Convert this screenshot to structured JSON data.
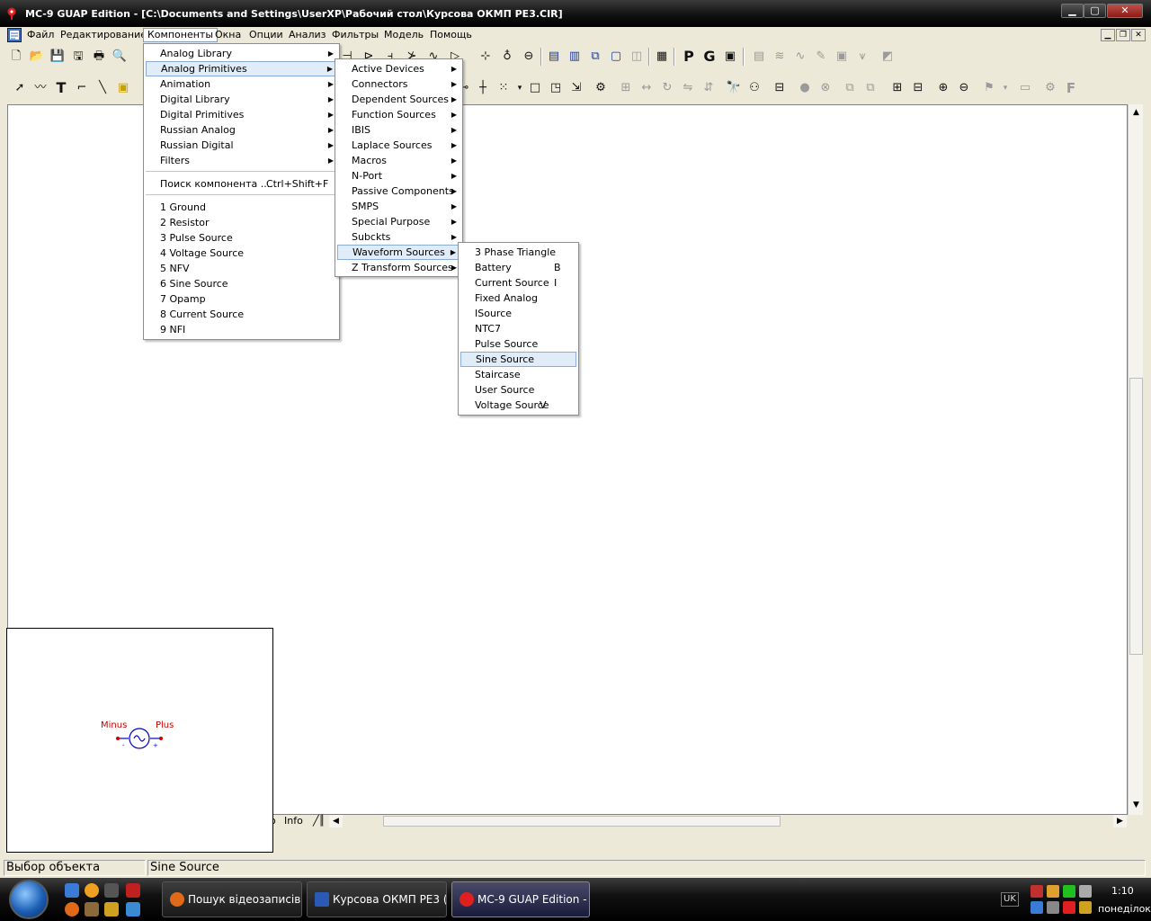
{
  "window": {
    "title": "MC-9 GUAP Edition - [C:\\Documents and Settings\\UserXP\\Рабочий стол\\Курсова ОКМП РЕ3.CIR]",
    "min": "▁",
    "max": "▢",
    "close": "✕"
  },
  "menubar": {
    "items": [
      "Файл",
      "Редактирование",
      "Компоненты",
      "Окна",
      "Опции",
      "Анализ",
      "Фильтры",
      "Модель",
      "Помощь"
    ],
    "active_index": 2
  },
  "menu_components": {
    "groups": [
      "Analog Library",
      "Analog Primitives",
      "Animation",
      "Digital Library",
      "Digital Primitives",
      "Russian Analog",
      "Russian Digital",
      "Filters"
    ],
    "find": {
      "label": "Поиск компонента ...",
      "shortcut": "Ctrl+Shift+F"
    },
    "recent": [
      "1 Ground",
      "2 Resistor",
      "3 Pulse Source",
      "4 Voltage Source",
      "5 NFV",
      "6 Sine Source",
      "7 Opamp",
      "8 Current Source",
      "9 NFI"
    ]
  },
  "menu_analog_primitives": {
    "items": [
      "Active Devices",
      "Connectors",
      "Dependent Sources",
      "Function Sources",
      "IBIS",
      "Laplace Sources",
      "Macros",
      "N-Port",
      "Passive Components",
      "SMPS",
      "Special Purpose",
      "Subckts",
      "Waveform Sources",
      "Z Transform Sources"
    ],
    "highlighted": "Waveform Sources"
  },
  "menu_waveform_sources": {
    "items": [
      {
        "label": "3 Phase Triangle",
        "shortcut": ""
      },
      {
        "label": "Battery",
        "shortcut": "B"
      },
      {
        "label": "Current Source",
        "shortcut": "I"
      },
      {
        "label": "Fixed Analog",
        "shortcut": ""
      },
      {
        "label": "ISource",
        "shortcut": ""
      },
      {
        "label": "NTC7",
        "shortcut": ""
      },
      {
        "label": "Pulse Source",
        "shortcut": ""
      },
      {
        "label": "Sine Source",
        "shortcut": ""
      },
      {
        "label": "Staircase",
        "shortcut": ""
      },
      {
        "label": "User Source",
        "shortcut": ""
      },
      {
        "label": "Voltage Source",
        "shortcut": "V"
      }
    ],
    "highlighted": "Sine Source"
  },
  "preview": {
    "minus_label": "Minus",
    "plus_label": "Plus",
    "color": "#cc0000",
    "symbol_color": "#0000cc"
  },
  "tabs": {
    "info_label": "Info"
  },
  "status": {
    "left": "Выбор объекта",
    "right": "Sine Source"
  },
  "taskbar": {
    "tasks": [
      {
        "label": "Пошук відеозаписів ..."
      },
      {
        "label": "Курсова ОКМП РЕ3 (..."
      },
      {
        "label": "MC-9 GUAP Edition - [..."
      }
    ],
    "lang": "UK",
    "clock": "1:10",
    "day": "понеділок"
  }
}
